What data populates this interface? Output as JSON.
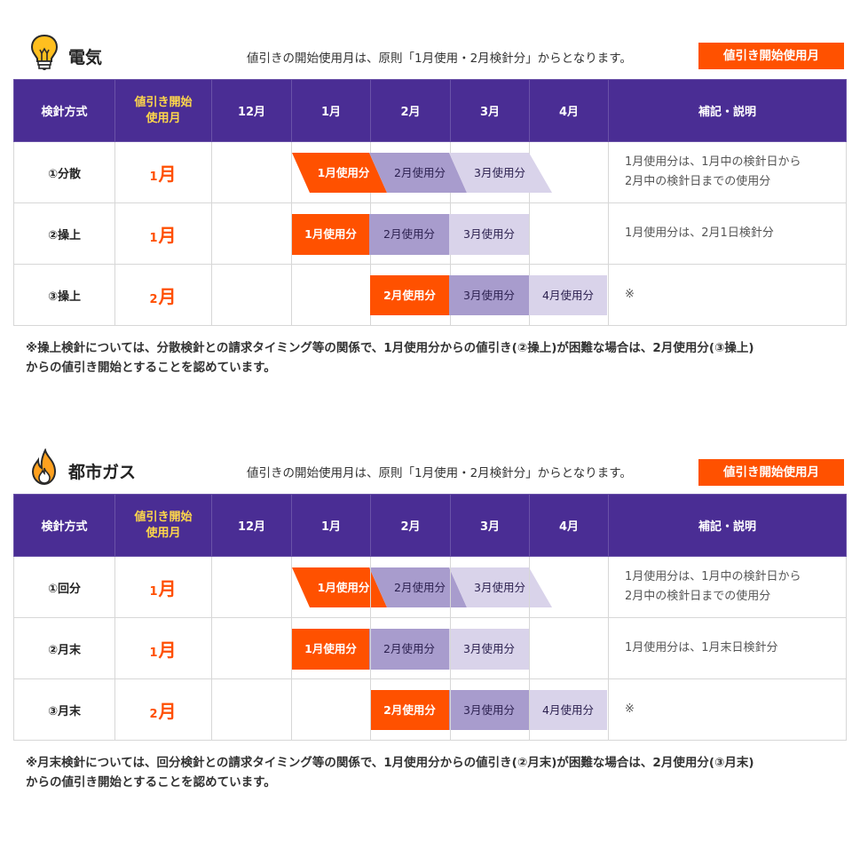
{
  "colors": {
    "accent": "#ff5100",
    "header_bg": "#4a2d94",
    "mid_bar": "#a89ccd",
    "light_bar": "#d9d3ea",
    "start_text": "#ffd84a"
  },
  "sections": [
    {
      "icon": "light-bulb-icon",
      "title": "電気",
      "note": "値引きの開始使用月は、原則「1月使用・2月検針分」からとなります。",
      "badge": "値引き開始使用月",
      "headers": {
        "method": "検針方式",
        "start_line1": "値引き開始",
        "start_line2": "使用月",
        "months": [
          "12月",
          "1月",
          "2月",
          "3月",
          "4月"
        ],
        "remarks": "補記・説明"
      },
      "rows": [
        {
          "method": "①分散",
          "start_num": "1",
          "start_unit": "月",
          "bars": [
            "1月使用分",
            "2月使用分",
            "3月使用分"
          ],
          "note_line1": "1月使用分は、1月中の検針日から",
          "note_line2": "2月中の検針日までの使用分"
        },
        {
          "method": "②操上",
          "start_num": "1",
          "start_unit": "月",
          "bars": [
            "1月使用分",
            "2月使用分",
            "3月使用分"
          ],
          "note_line1": "1月使用分は、2月1日検針分",
          "note_line2": ""
        },
        {
          "method": "③操上",
          "start_num": "2",
          "start_unit": "月",
          "bars": [
            "2月使用分",
            "3月使用分",
            "4月使用分"
          ],
          "note_line1": "※",
          "note_line2": ""
        }
      ],
      "footnote_line1": "※操上検針については、分散検針との請求タイミング等の関係で、1月使用分からの値引き(②操上)が困難な場合は、2月使用分(③操上)",
      "footnote_line2": "からの値引き開始とすることを認めています。"
    },
    {
      "icon": "flame-icon",
      "title": "都市ガス",
      "note": "値引きの開始使用月は、原則「1月使用・2月検針分」からとなります。",
      "badge": "値引き開始使用月",
      "headers": {
        "method": "検針方式",
        "start_line1": "値引き開始",
        "start_line2": "使用月",
        "months": [
          "12月",
          "1月",
          "2月",
          "3月",
          "4月"
        ],
        "remarks": "補記・説明"
      },
      "rows": [
        {
          "method": "①回分",
          "start_num": "1",
          "start_unit": "月",
          "bars": [
            "1月使用分",
            "2月使用分",
            "3月使用分"
          ],
          "note_line1": "1月使用分は、1月中の検針日から",
          "note_line2": "2月中の検針日までの使用分"
        },
        {
          "method": "②月末",
          "start_num": "1",
          "start_unit": "月",
          "bars": [
            "1月使用分",
            "2月使用分",
            "3月使用分"
          ],
          "note_line1": "1月使用分は、1月末日検針分",
          "note_line2": ""
        },
        {
          "method": "③月末",
          "start_num": "2",
          "start_unit": "月",
          "bars": [
            "2月使用分",
            "3月使用分",
            "4月使用分"
          ],
          "note_line1": "※",
          "note_line2": ""
        }
      ],
      "footnote_line1": "※月末検針については、回分検針との請求タイミング等の関係で、1月使用分からの値引き(②月末)が困難な場合は、2月使用分(③月末)",
      "footnote_line2": "からの値引き開始とすることを認めています。"
    }
  ]
}
